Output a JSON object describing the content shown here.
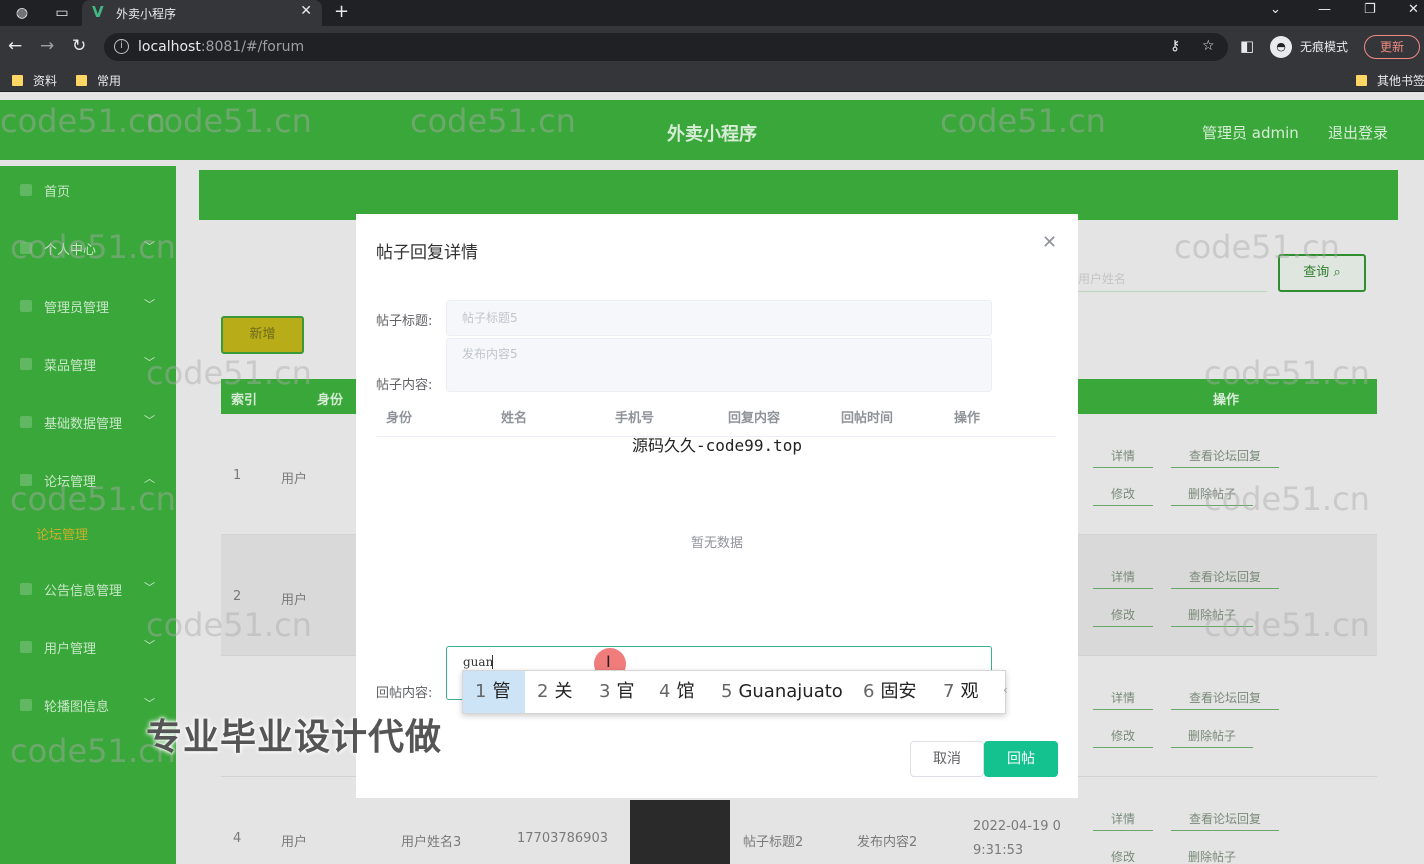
{
  "browser": {
    "tab_title": "外卖小程序",
    "url_host": "localhost",
    "url_rest": ":8081/#/forum",
    "incognito_label": "无痕模式",
    "update_label": "更新",
    "bookmarks": [
      "资料",
      "常用"
    ],
    "other_bookmarks": "其他书签"
  },
  "header": {
    "app_title": "外卖小程序",
    "user_label": "管理员 admin",
    "logout_label": "退出登录"
  },
  "sidebar": {
    "items": [
      {
        "label": "首页"
      },
      {
        "label": "个人中心"
      },
      {
        "label": "管理员管理"
      },
      {
        "label": "菜品管理"
      },
      {
        "label": "基础数据管理"
      },
      {
        "label": "论坛管理"
      },
      {
        "label": "公告信息管理"
      },
      {
        "label": "用户管理"
      },
      {
        "label": "轮播图信息"
      }
    ],
    "active_sub": "论坛管理"
  },
  "toolbar": {
    "search_placeholder": "用户姓名",
    "search_button": "查询",
    "add_button": "新增"
  },
  "table": {
    "headers": [
      "索引",
      "身份",
      "操作"
    ],
    "rows": [
      {
        "index": "1",
        "role": "用户"
      },
      {
        "index": "2",
        "role": "用户"
      },
      {
        "index": "",
        "role": ""
      },
      {
        "index": "4",
        "role": "用户",
        "name": "用户姓名3",
        "phone": "17703786903",
        "title": "帖子标题2",
        "content": "发布内容2",
        "time_line1": "2022-04-19 0",
        "time_line2": "9:31:53"
      }
    ],
    "actions": {
      "detail": "详情",
      "view_replies": "查看论坛回复",
      "edit": "修改",
      "delete": "删除帖子"
    }
  },
  "dialog": {
    "title": "帖子回复详情",
    "post_title_label": "帖子标题:",
    "post_title_value": "帖子标题5",
    "post_content_label": "帖子内容:",
    "post_content_value": "发布内容5",
    "columns": [
      "身份",
      "姓名",
      "手机号",
      "回复内容",
      "回帖时间",
      "操作"
    ],
    "brand_text": "源码久久-code99.top",
    "empty_text": "暂无数据",
    "reply_label": "回帖内容:",
    "reply_value": "guan",
    "cancel_label": "取消",
    "submit_label": "回帖"
  },
  "ime": {
    "candidates": [
      {
        "num": "1",
        "text": "管"
      },
      {
        "num": "2",
        "text": "关"
      },
      {
        "num": "3",
        "text": "官"
      },
      {
        "num": "4",
        "text": "馆"
      },
      {
        "num": "5",
        "text": "Guanajuato"
      },
      {
        "num": "6",
        "text": "固安"
      },
      {
        "num": "7",
        "text": "观"
      }
    ]
  },
  "overlay_caption": "专业毕业设计代做",
  "watermark_text": "code51.cn",
  "colors": {
    "primary_green": "#3aa73a",
    "reply_button": "#13c28f",
    "add_button": "#b8ad19"
  }
}
